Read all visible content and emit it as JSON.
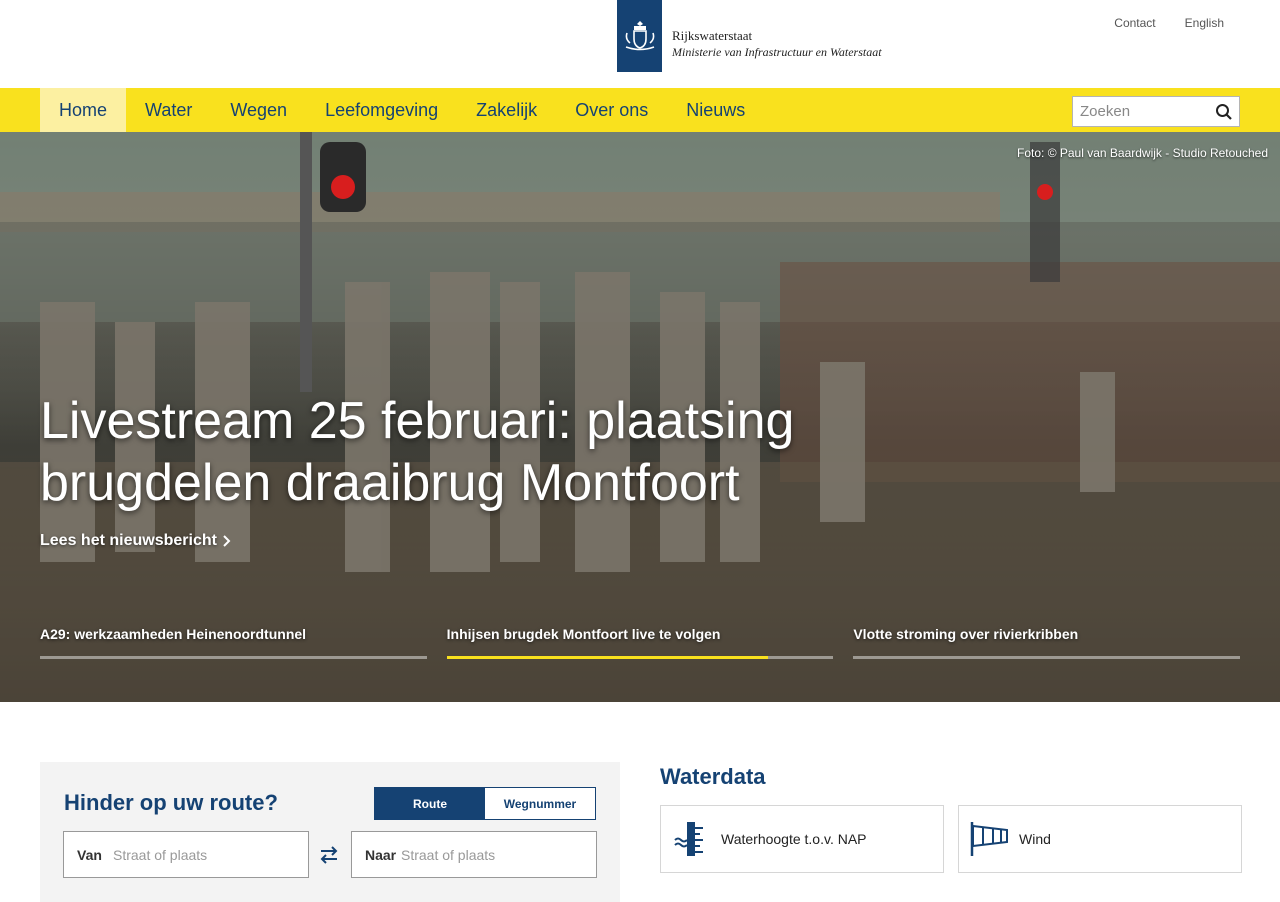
{
  "brand": {
    "name": "Rijkswaterstaat",
    "ministry": "Ministerie van Infrastructuur en Waterstaat"
  },
  "toplinks": [
    "Contact",
    "English"
  ],
  "nav": {
    "items": [
      "Home",
      "Water",
      "Wegen",
      "Leefomgeving",
      "Zakelijk",
      "Over ons",
      "Nieuws"
    ],
    "active": "Home"
  },
  "search": {
    "placeholder": "Zoeken"
  },
  "hero": {
    "credit": "Foto: © Paul van Baardwijk - Studio Retouched",
    "title": "Livestream 25 februari: plaatsing brugdelen draaibrug Montfoort",
    "link": "Lees het nieuwsbericht",
    "slides": [
      {
        "label": "A29: werkzaamheden Heinenoordtunnel",
        "progress": 0
      },
      {
        "label": "Inhijsen brugdek Montfoort live te volgen",
        "progress": 0.83
      },
      {
        "label": "Vlotte stroming over rivierkribben",
        "progress": 0
      }
    ],
    "accent": "#f9e11e"
  },
  "route": {
    "title": "Hinder op uw route?",
    "toggle": {
      "route": "Route",
      "road": "Wegnummer"
    },
    "from_label": "Van",
    "to_label": "Naar",
    "from_placeholder": "Straat of plaats",
    "to_placeholder": "Straat of plaats"
  },
  "waterdata": {
    "title": "Waterdata",
    "cards": [
      {
        "label": "Waterhoogte t.o.v. NAP",
        "icon": "water-level-icon"
      },
      {
        "label": "Wind",
        "icon": "windsock-icon"
      }
    ]
  },
  "colors": {
    "brand": "#154273",
    "nav": "#f9e11e",
    "nav_active": "#fcf0a1"
  }
}
